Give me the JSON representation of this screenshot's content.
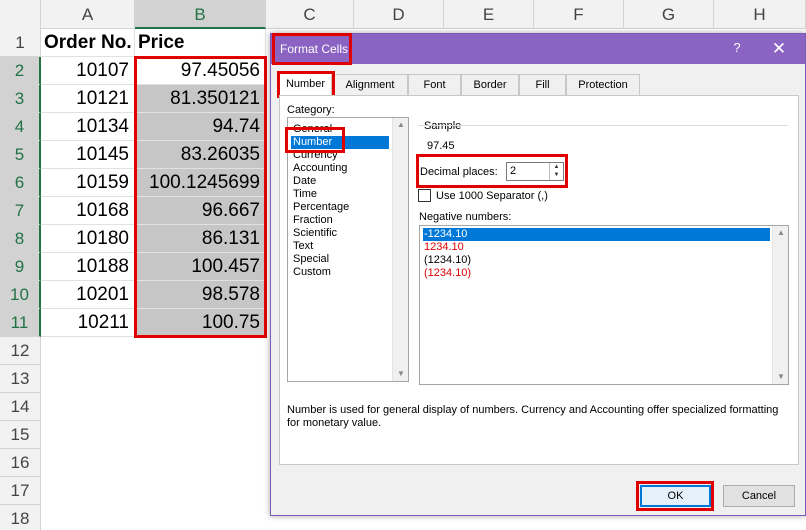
{
  "sheet": {
    "columns": [
      "A",
      "B",
      "C",
      "D",
      "E",
      "F",
      "G",
      "H"
    ],
    "rows": [
      "1",
      "2",
      "3",
      "4",
      "5",
      "6",
      "7",
      "8",
      "9",
      "10",
      "11",
      "12",
      "13",
      "14",
      "15",
      "16",
      "17",
      "18"
    ],
    "header_order": "Order No.",
    "header_price": "Price",
    "orders": [
      "10107",
      "10121",
      "10134",
      "10145",
      "10159",
      "10168",
      "10180",
      "10188",
      "10201",
      "10211"
    ],
    "prices": [
      "97.45056",
      "81.350121",
      "94.74",
      "83.26035",
      "100.1245699",
      "96.667",
      "86.131",
      "100.457",
      "98.578",
      "100.75"
    ]
  },
  "dialog": {
    "title": "Format Cells",
    "help": "?",
    "close": "✕",
    "tabs": [
      "Number",
      "Alignment",
      "Font",
      "Border",
      "Fill",
      "Protection"
    ],
    "category_label": "Category:",
    "categories": [
      "General",
      "Number",
      "Currency",
      "Accounting",
      "Date",
      "Time",
      "Percentage",
      "Fraction",
      "Scientific",
      "Text",
      "Special",
      "Custom"
    ],
    "selected_category": "Number",
    "sample_label": "Sample",
    "sample_value": "97.45",
    "decimal_label": "Decimal places:",
    "decimal_value": "2",
    "separator_label": "Use 1000 Separator (,)",
    "separator_checked": false,
    "negative_label": "Negative numbers:",
    "negatives": [
      "-1234.10",
      "1234.10",
      "(1234.10)",
      "(1234.10)"
    ],
    "description": "Number is used for general display of numbers.  Currency and Accounting offer specialized formatting for monetary value.",
    "ok": "OK",
    "cancel": "Cancel"
  },
  "colors": {
    "titlebar": "#8a63c3",
    "highlight": "#e00000",
    "selection": "#0078d7",
    "excel_green": "#217346"
  }
}
